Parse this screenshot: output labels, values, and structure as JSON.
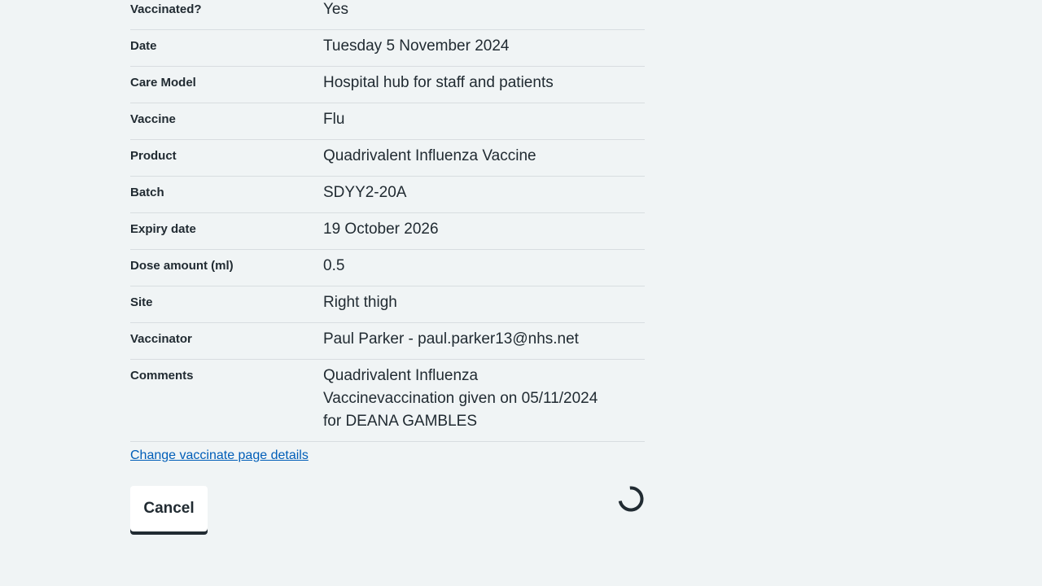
{
  "summary": {
    "rows": [
      {
        "key": "Vaccinated?",
        "value": "Yes"
      },
      {
        "key": "Date",
        "value": "Tuesday 5 November 2024"
      },
      {
        "key": "Care Model",
        "value": "Hospital hub for staff and patients"
      },
      {
        "key": "Vaccine",
        "value": "Flu"
      },
      {
        "key": "Product",
        "value": "Quadrivalent Influenza Vaccine"
      },
      {
        "key": "Batch",
        "value": "SDYY2-20A"
      },
      {
        "key": "Expiry date",
        "value": "19 October 2026"
      },
      {
        "key": "Dose amount (ml)",
        "value": "0.5"
      },
      {
        "key": "Site",
        "value": "Right thigh"
      },
      {
        "key": "Vaccinator",
        "value": "Paul Parker - paul.parker13@nhs.net"
      },
      {
        "key": "Comments",
        "value": "Quadrivalent Influenza\nVaccinevaccination given on 05/11/2024\nfor DEANA GAMBLES"
      }
    ]
  },
  "actions": {
    "change_link": "Change vaccinate page details",
    "cancel_label": "Cancel"
  },
  "icons": {
    "spinner": "loading-spinner-icon"
  },
  "colors": {
    "background": "#f0f4f5",
    "link": "#005eb8",
    "text": "#212b32",
    "divider": "#d8dde0"
  }
}
